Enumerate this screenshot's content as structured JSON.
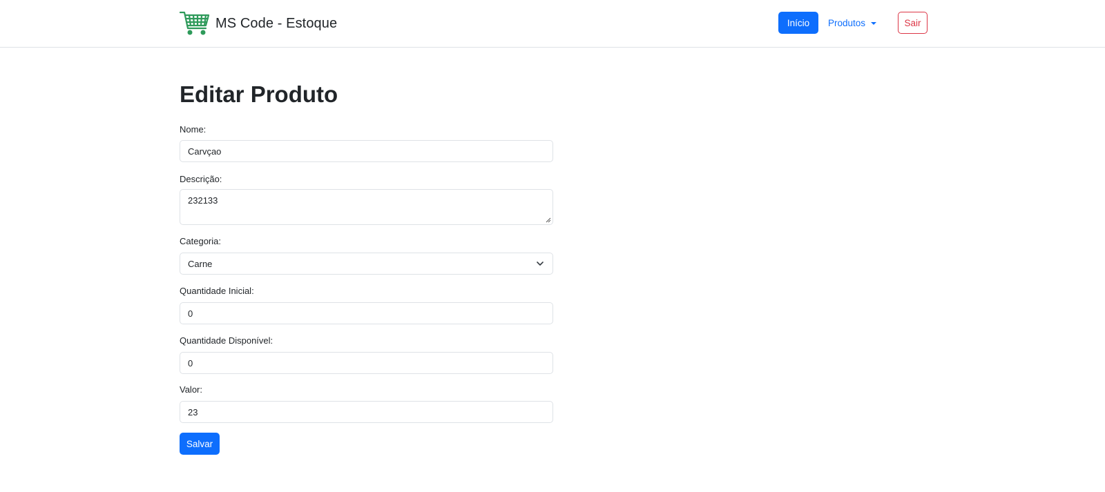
{
  "navbar": {
    "brand_icon": "shopping-cart-icon",
    "brand_icon_color": "#2e9a5a",
    "brand_text": "MS Code - Estoque",
    "inicio_label": "Início",
    "produtos_label": "Produtos",
    "sair_label": "Sair"
  },
  "page": {
    "title": "Editar Produto"
  },
  "form": {
    "nome": {
      "label": "Nome:",
      "value": "Carvçao"
    },
    "descricao": {
      "label": "Descrição:",
      "value": "232133"
    },
    "categoria": {
      "label": "Categoria:",
      "value": "Carne"
    },
    "quantidade_inicial": {
      "label": "Quantidade Inicial:",
      "value": "0"
    },
    "quantidade_disponivel": {
      "label": "Quantidade Disponível:",
      "value": "0"
    },
    "valor": {
      "label": "Valor:",
      "value": "23"
    },
    "submit_label": "Salvar"
  },
  "colors": {
    "primary": "#0d6efd",
    "danger": "#dc3545",
    "brand_icon": "#2e9a5a"
  }
}
